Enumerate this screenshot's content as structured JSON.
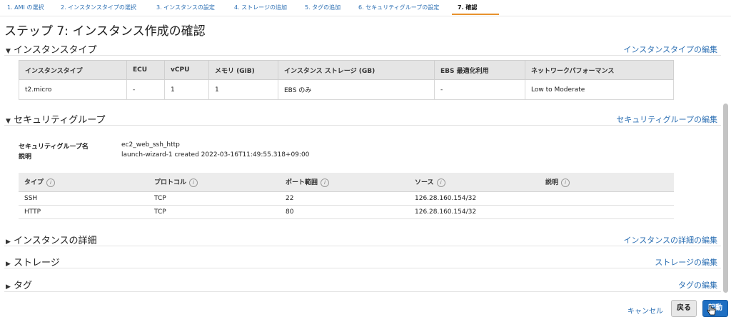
{
  "wizard": {
    "steps": [
      "1. AMI の選択",
      "2. インスタンスタイプの選択",
      "3. インスタンスの設定",
      "4. ストレージの追加",
      "5. タグの追加",
      "6. セキュリティグループの設定",
      "7. 確認"
    ],
    "active_step": 7
  },
  "page": {
    "title": "ステップ 7: インスタンス作成の確認"
  },
  "instance_type": {
    "heading": "インスタンスタイプ",
    "edit_link": "インスタンスタイプの編集",
    "columns": [
      "インスタンスタイプ",
      "ECU",
      "vCPU",
      "メモリ (GiB)",
      "インスタンス ストレージ (GB)",
      "EBS 最適化利用",
      "ネットワークパフォーマンス"
    ],
    "row": [
      "t2.micro",
      "-",
      "1",
      "1",
      "EBS のみ",
      "-",
      "Low to Moderate"
    ]
  },
  "security_group": {
    "heading": "セキュリティグループ",
    "edit_link": "セキュリティグループの編集",
    "name_label": "セキュリティグループ名",
    "name_value": "ec2_web_ssh_http",
    "desc_label": "説明",
    "desc_value": "launch-wizard-1 created 2022-03-16T11:49:55.318+09:00",
    "columns": [
      "タイプ",
      "プロトコル",
      "ポート範囲",
      "ソース",
      "説明"
    ],
    "rows": [
      [
        "SSH",
        "TCP",
        "22",
        "126.28.160.154/32",
        ""
      ],
      [
        "HTTP",
        "TCP",
        "80",
        "126.28.160.154/32",
        ""
      ]
    ]
  },
  "instance_details": {
    "heading": "インスタンスの詳細",
    "edit_link": "インスタンスの詳細の編集"
  },
  "storage": {
    "heading": "ストレージ",
    "edit_link": "ストレージの編集"
  },
  "tags": {
    "heading": "タグ",
    "edit_link": "タグの編集"
  },
  "footer": {
    "cancel": "キャンセル",
    "back": "戻る",
    "launch": "起動"
  },
  "colors": {
    "link": "#2c6fb3",
    "primary_button": "#1f6fc2",
    "active_step_underline": "#e8912d"
  },
  "icons": {
    "expanded": "caret-down-icon",
    "collapsed": "caret-right-icon",
    "info": "info-icon",
    "pointer": "hand-cursor-icon"
  }
}
